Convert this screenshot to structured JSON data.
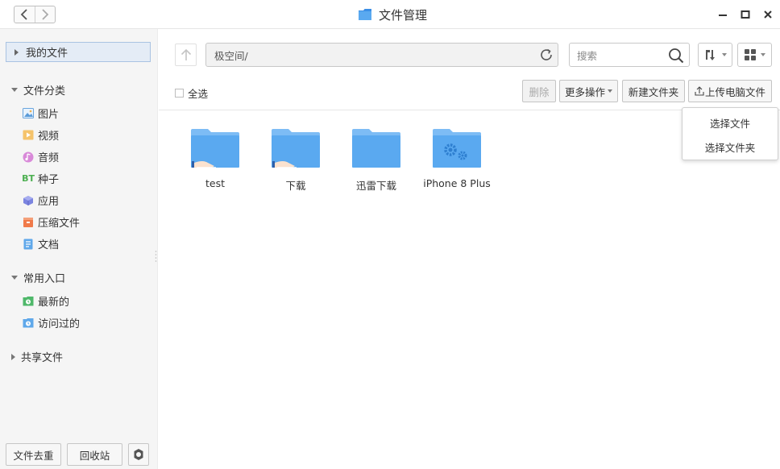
{
  "window": {
    "title": "文件管理"
  },
  "sidebar": {
    "my_files": "我的文件",
    "categories": {
      "title": "文件分类",
      "items": [
        {
          "label": "图片",
          "icon": "image-icon"
        },
        {
          "label": "视频",
          "icon": "video-icon"
        },
        {
          "label": "音频",
          "icon": "audio-icon"
        },
        {
          "label": "种子",
          "icon": "torrent-icon"
        },
        {
          "label": "应用",
          "icon": "app-icon"
        },
        {
          "label": "压缩文件",
          "icon": "archive-icon"
        },
        {
          "label": "文档",
          "icon": "document-icon"
        }
      ]
    },
    "common": {
      "title": "常用入口",
      "items": [
        {
          "label": "最新的",
          "icon": "recent-icon"
        },
        {
          "label": "访问过的",
          "icon": "visited-icon"
        }
      ]
    },
    "shared": "共享文件",
    "footer": {
      "dedupe": "文件去重",
      "recycle": "回收站"
    }
  },
  "toolbar": {
    "path": "极空间/",
    "search_placeholder": "搜索"
  },
  "actions": {
    "select_all": "全选",
    "delete": "删除",
    "more": "更多操作",
    "new_folder": "新建文件夹",
    "upload": "上传电脑文件"
  },
  "upload_menu": [
    "选择文件",
    "选择文件夹"
  ],
  "files": [
    {
      "name": "test",
      "type": "shared-folder"
    },
    {
      "name": "下载",
      "type": "shared-folder"
    },
    {
      "name": "迅雷下载",
      "type": "folder"
    },
    {
      "name": "iPhone 8 Plus",
      "type": "system-folder"
    }
  ],
  "colors": {
    "folder": "#5aa9f0",
    "folder_tab": "#7dbcf5",
    "accent": "#a9c3e2"
  }
}
